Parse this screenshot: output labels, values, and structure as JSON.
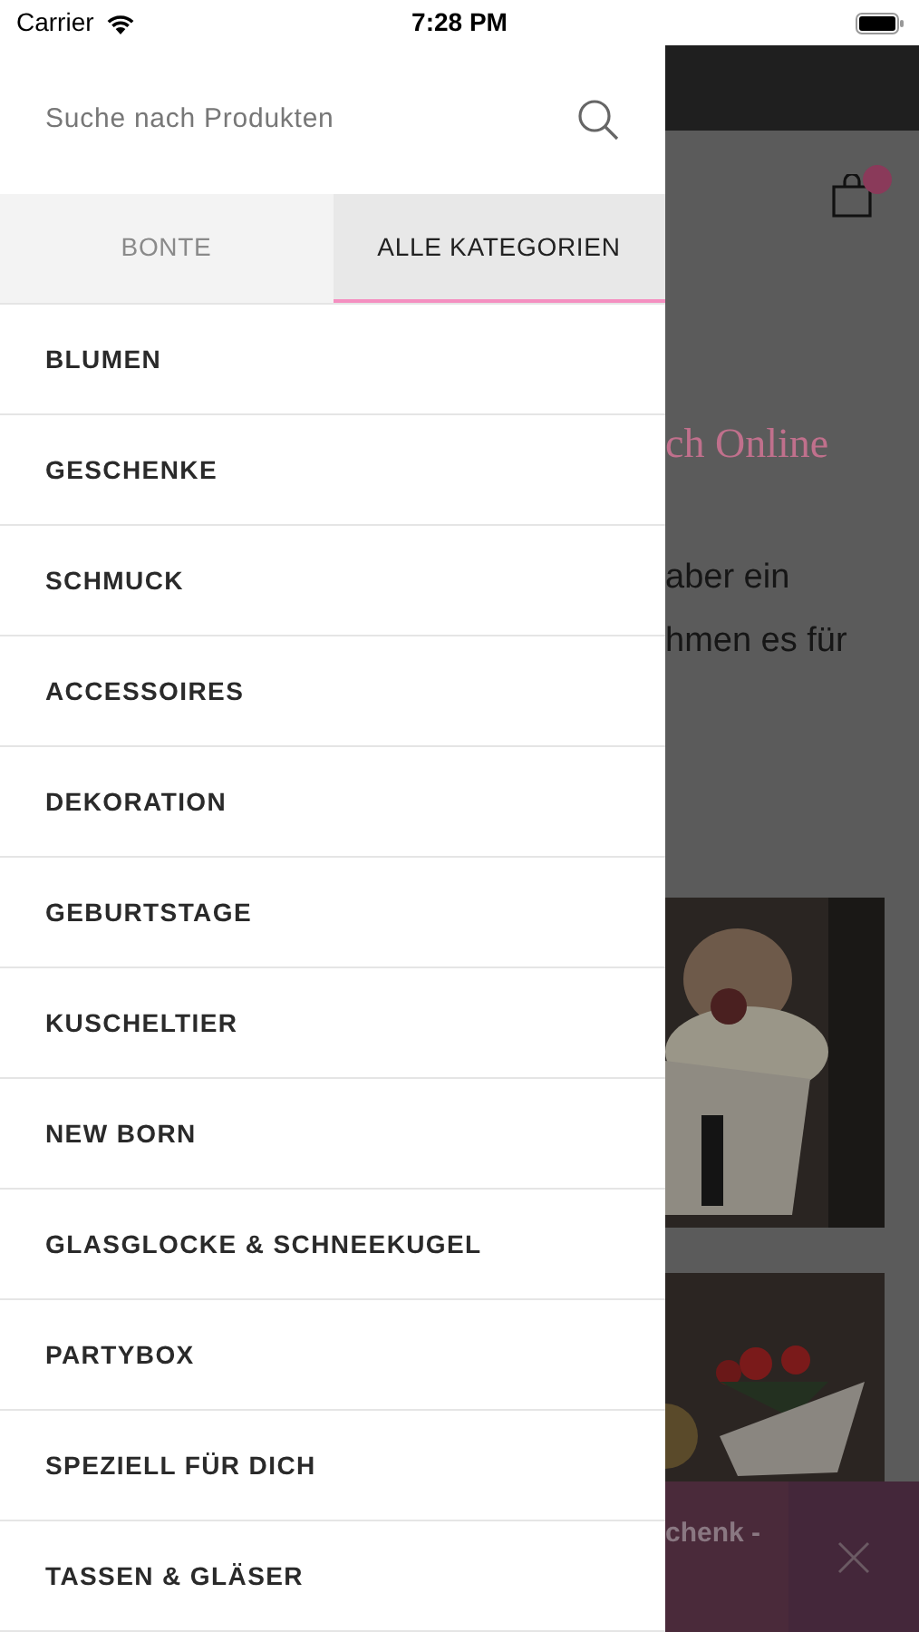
{
  "status_bar": {
    "carrier": "Carrier",
    "time": "7:28 PM"
  },
  "drawer": {
    "search": {
      "placeholder": "Suche nach Produkten"
    },
    "tabs": [
      {
        "label": "BONTE",
        "selected": false
      },
      {
        "label": "ALLE KATEGORIEN",
        "selected": true
      }
    ],
    "categories": [
      "BLUMEN",
      "GESCHENKE",
      "SCHMUCK",
      "ACCESSOIRES",
      "DEKORATION",
      "GEBURTSTAGE",
      "KUSCHELTIER",
      "NEW BORN",
      "GLASGLOCKE & SCHNEEKUGEL",
      "PARTYBOX",
      "SPEZIELL FÜR DICH",
      "TASSEN & GLÄSER"
    ]
  },
  "background_page": {
    "headline": "ch Online",
    "text_lines": [
      "aber ein",
      "hmen es für"
    ],
    "banner": {
      "text": "chenk -"
    }
  }
}
